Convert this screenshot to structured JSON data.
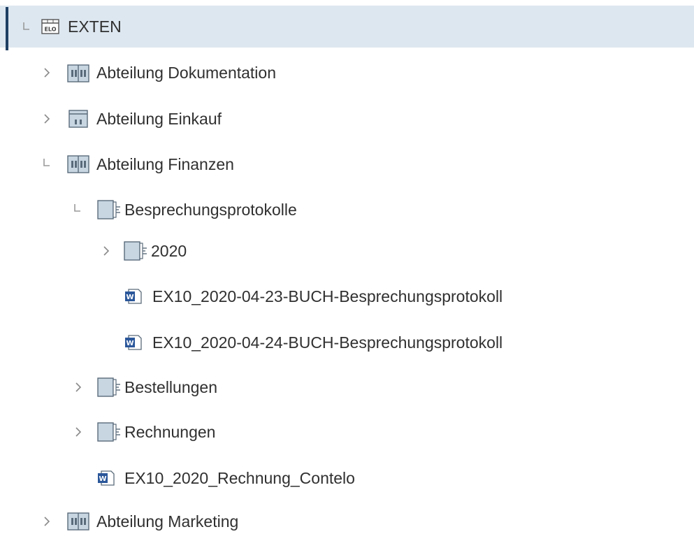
{
  "tree": {
    "root": {
      "label": "EXTEN",
      "icon": "elo-repository-icon",
      "state": "expanded"
    },
    "items": [
      {
        "label": "Abteilung Dokumentation",
        "icon": "cabinet-icon",
        "state": "collapsed"
      },
      {
        "label": "Abteilung Einkauf",
        "icon": "cabinet-single-icon",
        "state": "collapsed"
      },
      {
        "label": "Abteilung Finanzen",
        "icon": "cabinet-icon",
        "state": "expanded"
      },
      {
        "label": "Besprechungsprotokolle",
        "icon": "folder-icon",
        "state": "expanded"
      },
      {
        "label": "2020",
        "icon": "folder-icon",
        "state": "collapsed"
      },
      {
        "label": "EX10_2020-04-23-BUCH-Besprechungsprotokoll",
        "icon": "word-document-icon",
        "state": "leaf"
      },
      {
        "label": "EX10_2020-04-24-BUCH-Besprechungsprotokoll",
        "icon": "word-document-icon",
        "state": "leaf"
      },
      {
        "label": "Bestellungen",
        "icon": "folder-icon",
        "state": "collapsed"
      },
      {
        "label": "Rechnungen",
        "icon": "folder-icon",
        "state": "collapsed"
      },
      {
        "label": "EX10_2020_Rechnung_Contelo",
        "icon": "word-document-icon",
        "state": "leaf"
      },
      {
        "label": "Abteilung Marketing",
        "icon": "cabinet-icon",
        "state": "collapsed"
      }
    ]
  },
  "colors": {
    "selected_bg": "#dde7f0",
    "selection_bar": "#1f3f63",
    "icon_fill": "#c8d6e2",
    "icon_stroke": "#5a6b7a",
    "word_blue": "#2b579a"
  }
}
